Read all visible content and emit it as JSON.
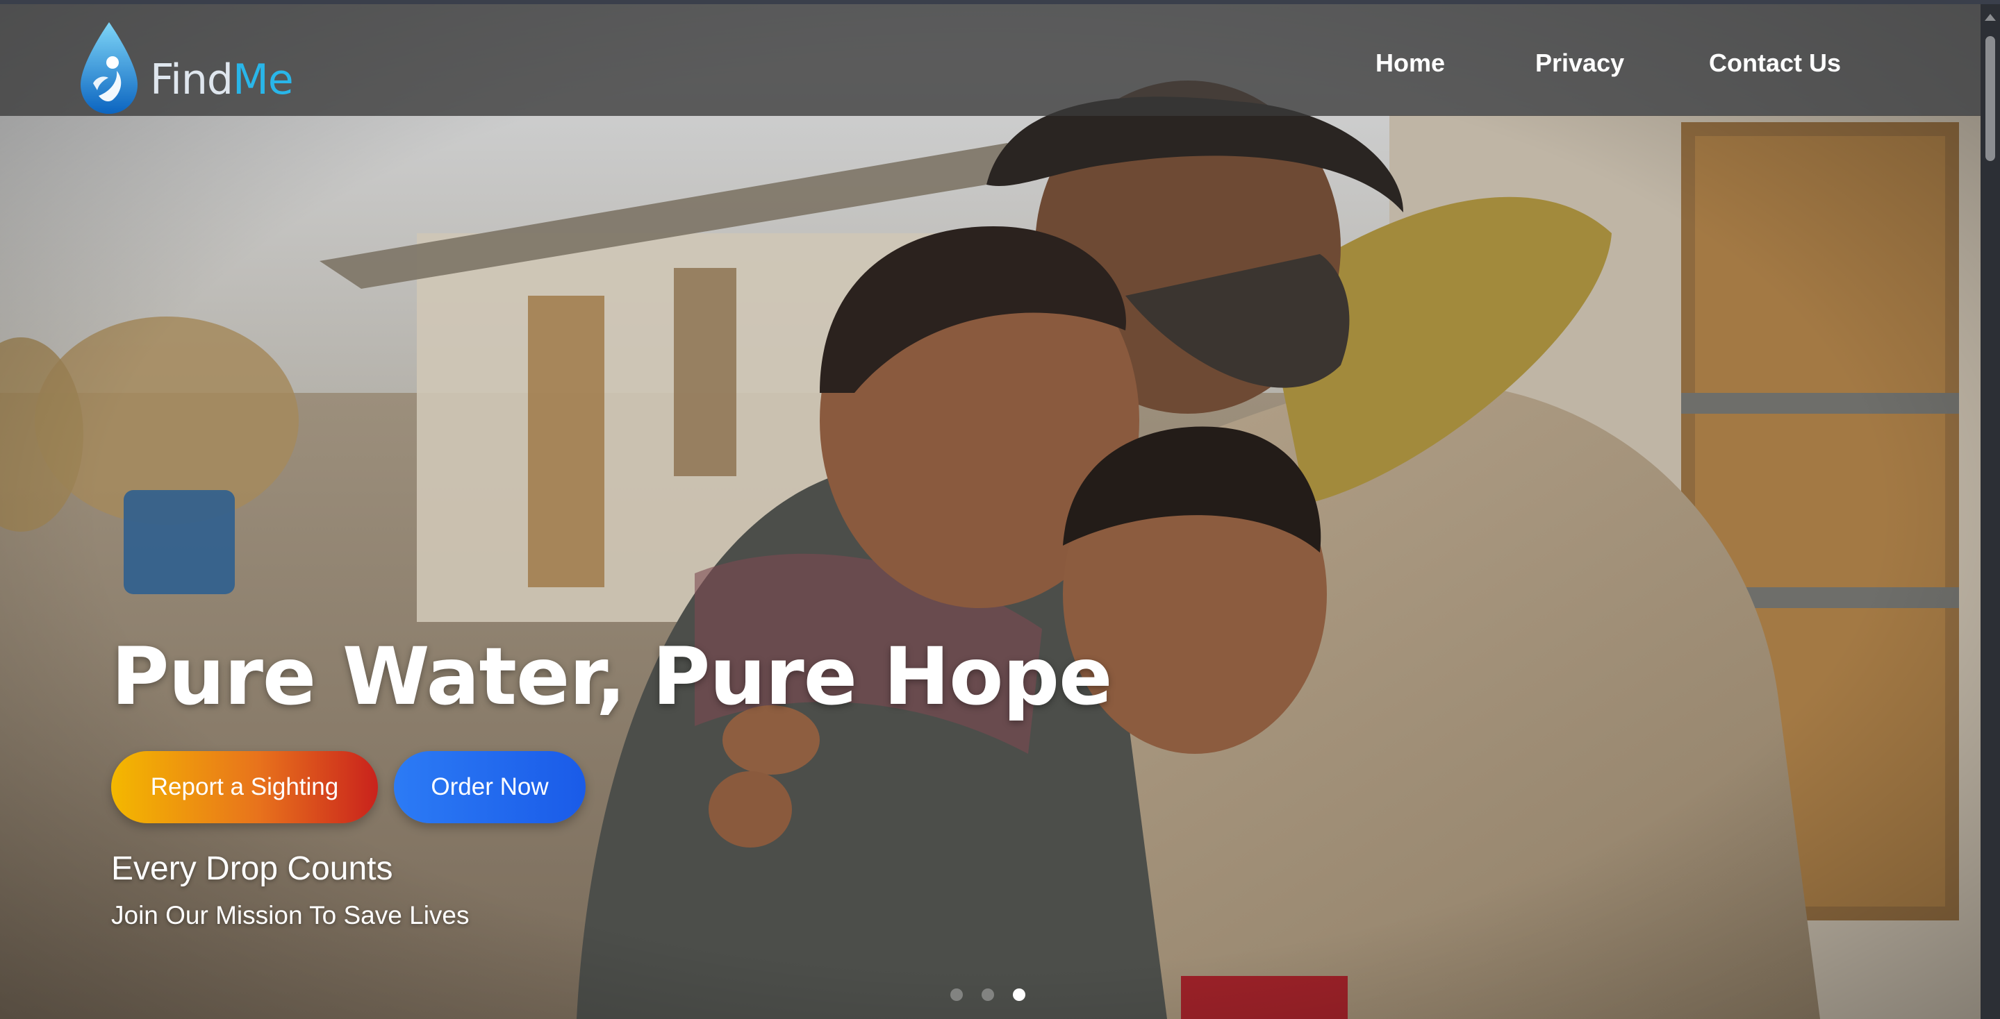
{
  "brand": {
    "name_part1": "Find",
    "name_part2": "Me"
  },
  "nav": {
    "home": "Home",
    "privacy": "Privacy",
    "contact": "Contact Us"
  },
  "hero": {
    "title": "Pure Water, Pure Hope",
    "report_button": "Report a Sighting",
    "order_button": "Order Now",
    "tagline": "Every Drop Counts",
    "subtagline": "Join Our Mission To Save Lives",
    "carousel": {
      "slide_count": 3,
      "active_slide": 3
    }
  },
  "colors": {
    "nav_background": "#3a3a3a",
    "brand_blue": "#29b6e9",
    "report_gradient": [
      "#f4b800",
      "#c9221c"
    ],
    "order_blue": "#1a5be8"
  }
}
